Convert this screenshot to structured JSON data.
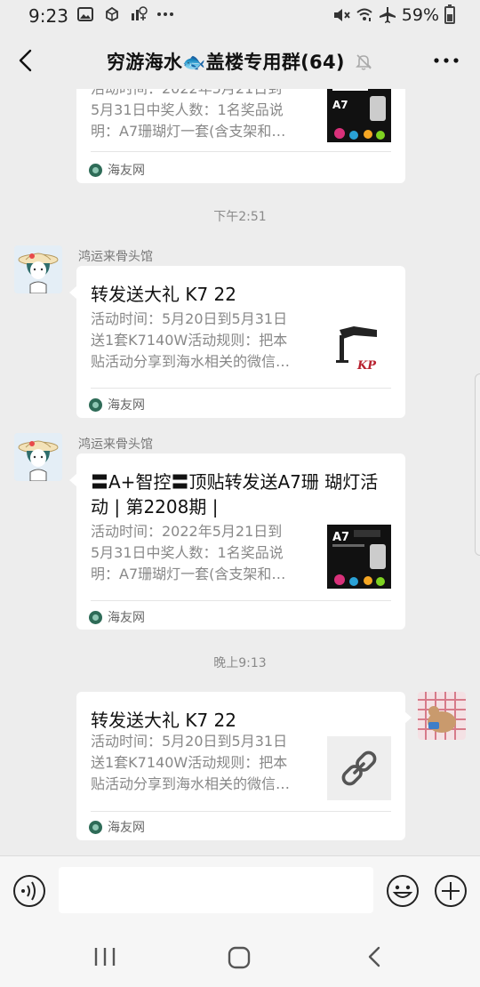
{
  "status_bar": {
    "time": "9:23",
    "battery": "59%",
    "battery_level": 0.59,
    "icons": [
      "image-icon",
      "box-icon",
      "no-signal-icon",
      "more-dots-icon",
      "mute-icon",
      "wifi-icon",
      "airplane-icon",
      "battery-icon"
    ]
  },
  "header": {
    "title": "穷游海水🐟盖楼专用群(64)",
    "back_icon": "chevron-left-icon",
    "mute_icon": "bell-off-icon",
    "more_icon": "more-dots-icon"
  },
  "messages": [
    {
      "type": "link-card",
      "side": "left",
      "partial": true,
      "title": "",
      "desc_lines": [
        "活动时间：2022年5月21日到",
        "5月31日中奖人数：1名奖品说",
        "明：A7珊瑚灯一套(含支架和…"
      ],
      "thumb_label": "A7",
      "source": "海友网"
    },
    {
      "type": "timestamp",
      "text": "下午2:51"
    },
    {
      "type": "link-card",
      "side": "left",
      "sender": "鸿运来骨头馆",
      "title": "转发送大礼 K7 22",
      "desc_lines": [
        "活动时间：5月20日到5月31日",
        "送1套K7140W活动规则：把本",
        "贴活动分享到海水相关的微信…"
      ],
      "thumb_label": "KP",
      "source": "海友网"
    },
    {
      "type": "link-card",
      "side": "left",
      "sender": "鸿运来骨头馆",
      "title": "〓A+智控〓顶贴转发送A7珊 瑚灯活动 | 第2208期 |",
      "desc_lines": [
        "活动时间：2022年5月21日到",
        "5月31日中奖人数：1名奖品说",
        "明：A7珊瑚灯一套(含支架和…"
      ],
      "thumb_label": "A7",
      "source": "海友网"
    },
    {
      "type": "timestamp",
      "text": "晚上9:13"
    },
    {
      "type": "link-card",
      "side": "right",
      "title": "转发送大礼 K7 22",
      "desc_lines": [
        "活动时间：5月20日到5月31日",
        "送1套K7140W活动规则：把本",
        "贴活动分享到海水相关的微信…"
      ],
      "thumb_icon": "link-icon",
      "source": "海友网"
    }
  ],
  "input_bar": {
    "voice_icon": "voice-icon",
    "text_value": "",
    "emoji_icon": "emoji-icon",
    "plus_icon": "plus-icon"
  },
  "nav_bar": {
    "recent_icon": "recent-apps-icon",
    "home_icon": "home-icon",
    "back_icon": "back-icon"
  },
  "colors": {
    "background": "#ededed",
    "card": "#ffffff",
    "secondary_text": "#888888",
    "timestamp_text": "#8a8a8a"
  }
}
